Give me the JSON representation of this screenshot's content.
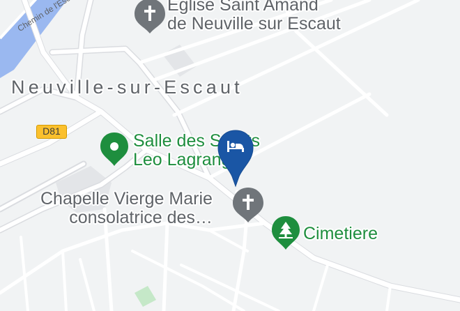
{
  "map": {
    "background_color": "#f1f3f4",
    "road_color": "#ffffff",
    "road_outline_color": "#dadce0",
    "water_color": "#9ab8f0",
    "park_color": "#c5e8c8",
    "building_color": "#e3e5e8",
    "street_label": "Chemin de l'Esc",
    "town_label": "Neuville-sur-Escaut",
    "road_shield": {
      "label": "D81",
      "color": "#fbc02d"
    },
    "pois": [
      {
        "name_line1": "Église Saint Amand",
        "name_line2": "de Neuville sur Escaut",
        "category": "church",
        "icon": "cross-icon",
        "color": "#5f6368"
      },
      {
        "name_line1": "Salle des Sports",
        "name_line2": "Leo Lagrange",
        "category": "place",
        "icon": "location-pin-icon",
        "color": "#1e8e3e"
      },
      {
        "name_line1": "Chapelle Vierge Marie",
        "name_line2": "consolatrice des…",
        "category": "church",
        "icon": "cross-icon",
        "color": "#5f6368"
      },
      {
        "name_line1": "Cimetiere",
        "category": "cemetery",
        "icon": "tree-icon",
        "color": "#1e8e3e"
      }
    ],
    "hotel_marker": {
      "icon": "bed-icon",
      "color": "#1a56a5"
    }
  }
}
